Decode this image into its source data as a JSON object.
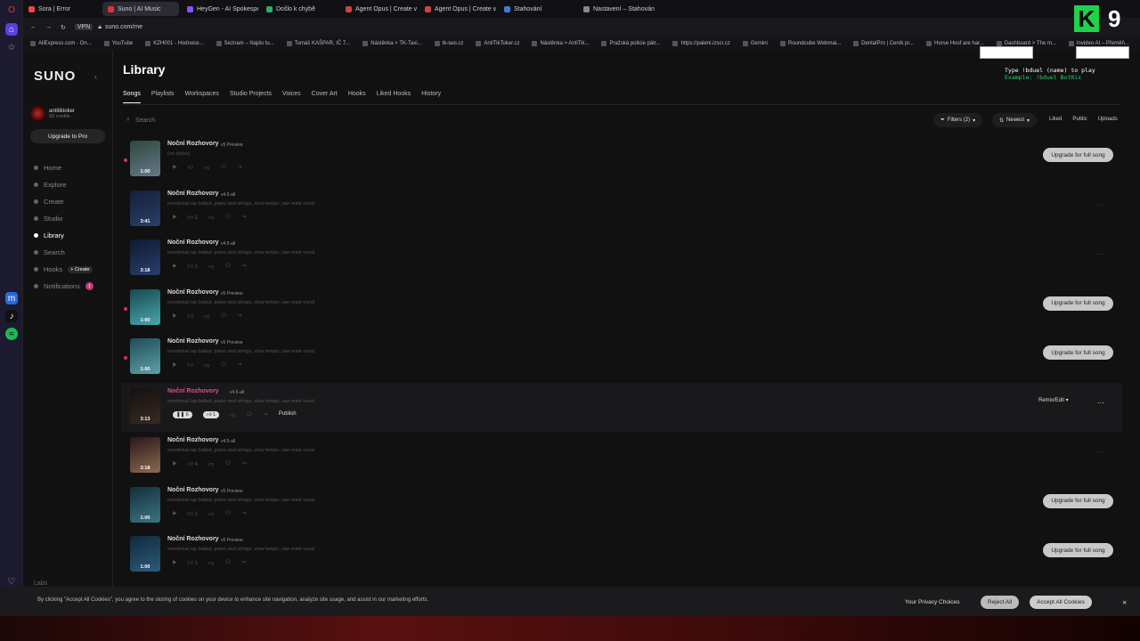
{
  "browser": {
    "tabs": [
      "Sora | Error",
      "Suno | AI Music",
      "HeyGen - AI Spokesperson",
      "Došlo k chybě",
      "Agent Opus | Create video",
      "Agent Opus | Create video",
      "Stahování",
      "Nastavení – Stahování"
    ],
    "url": "suno.com/me",
    "bookmarks": [
      "AliExpress.com - On...",
      "YouTube",
      "KZH001 - Hodnoce...",
      "Seznam – Najdu tu...",
      "Tomáš KAŠPAR, IČ 7...",
      "Nástěnka > TK-Taxi...",
      "tk-taxi.cz",
      "AntiTikToker.cz",
      "Nástěnka > AntiTik...",
      "Pražská policie pátr...",
      "https://paleni.izscr.cz",
      "Gemini",
      "Roundcube Webmai...",
      "DentalPro | Ceník pr...",
      "Horse Hoof are har...",
      "Dashboard > The m...",
      "Invideo AI – Přeměň...",
      "Fiiki - Turn text into..."
    ]
  },
  "sidebar": {
    "logo": "SUNO",
    "username": "antitiktoker",
    "credits": "50 credits",
    "upgrade": "Upgrade to Pro",
    "items": [
      "Home",
      "Explore",
      "Create",
      "Studio",
      "Library",
      "Search",
      "Hooks",
      "Notifications"
    ],
    "create_tag": "+ Create",
    "notif": "1",
    "labs": "Labs"
  },
  "main": {
    "title": "Library",
    "tabs": [
      "Songs",
      "Playlists",
      "Workspaces",
      "Studio Projects",
      "Voices",
      "Cover Art",
      "Hooks",
      "Liked Hooks",
      "History"
    ],
    "search": "Search",
    "filters": "Filters (2)",
    "sort": "Newest",
    "quick": [
      "Liked",
      "Public",
      "Uploads"
    ]
  },
  "songs": [
    {
      "title": "Noční Rozhovory",
      "ver": "v5 Preview",
      "desc": "(no styles)",
      "dur": "1:00",
      "dot": true,
      "upgrade": "Upgrade for full song",
      "c": [
        "#2d4a3f",
        "#678"
      ]
    },
    {
      "title": "Noční Rozhovory",
      "ver": "v4.5-all",
      "desc": "emotional rap ballad, piano and strings, slow tempo, raw male vocal",
      "dur": "3:41",
      "likes": "1",
      "c": [
        "#12203a",
        "#2b3f66"
      ]
    },
    {
      "title": "Noční Rozhovory",
      "ver": "v4.5-all",
      "desc": "emotional rap ballad, piano and strings, slow tempo, raw male vocal",
      "dur": "3:18",
      "likes": "1",
      "c": [
        "#0e1a33",
        "#283e6a"
      ]
    },
    {
      "title": "Noční Rozhovory",
      "ver": "v5 Preview",
      "desc": "emotional rap ballad, piano and strings, slow tempo, raw male vocal",
      "dur": "1:00",
      "dot": true,
      "upgrade": "Upgrade for full song",
      "c": [
        "#16494f",
        "#4aa7b0"
      ]
    },
    {
      "title": "Noční Rozhovory",
      "ver": "v5 Preview",
      "desc": "emotional rap ballad, piano and strings, slow tempo, raw male vocal",
      "dur": "1:00",
      "dot": true,
      "upgrade": "Upgrade for full song",
      "c": [
        "#1f4d57",
        "#5fa0a8"
      ]
    },
    {
      "title": "Noční Rozhovory",
      "ver": "v4.5-all",
      "desc": "emotional rap ballad, piano and strings, slow tempo, raw male vocal",
      "dur": "3:13",
      "hl": true,
      "plays": "6",
      "likes": "1",
      "publish": "Publish",
      "remix": "Remix/Edit",
      "c": [
        "#111",
        "#3a2a20"
      ]
    },
    {
      "title": "Noční Rozhovory",
      "ver": "v4.5-all",
      "desc": "emotional rap ballad, piano and strings, slow tempo, raw male vocal",
      "dur": "3:18",
      "likes": "4",
      "c": [
        "#2a1818",
        "#8b6a50"
      ]
    },
    {
      "title": "Noční Rozhovory",
      "ver": "v5 Preview",
      "desc": "emotional rap ballad, piano and strings, slow tempo, raw male vocal",
      "dur": "1:00",
      "likes": "1",
      "upgrade": "Upgrade for full song",
      "c": [
        "#13303a",
        "#3c7484"
      ]
    },
    {
      "title": "Noční Rozhovory",
      "ver": "v5 Preview",
      "desc": "emotional rap ballad, piano and strings, slow tempo, raw male vocal",
      "dur": "1:00",
      "likes": "1",
      "upgrade": "Upgrade for full song",
      "c": [
        "#102a3c",
        "#2c5b7a"
      ]
    }
  ],
  "cookie": {
    "text": "By clicking \"Accept All Cookies\", you agree to the storing of cookies on your device to enhance site navigation, analyze site usage, and assist in our marketing efforts.",
    "privacy": "Your Privacy Choices",
    "reject": "Reject All",
    "accept": "Accept All Cookies"
  },
  "overlay": {
    "type": "Type !bduel (name) to play",
    "example": "Example: !bduel BotRix",
    "k": "K",
    "nine": "9"
  }
}
